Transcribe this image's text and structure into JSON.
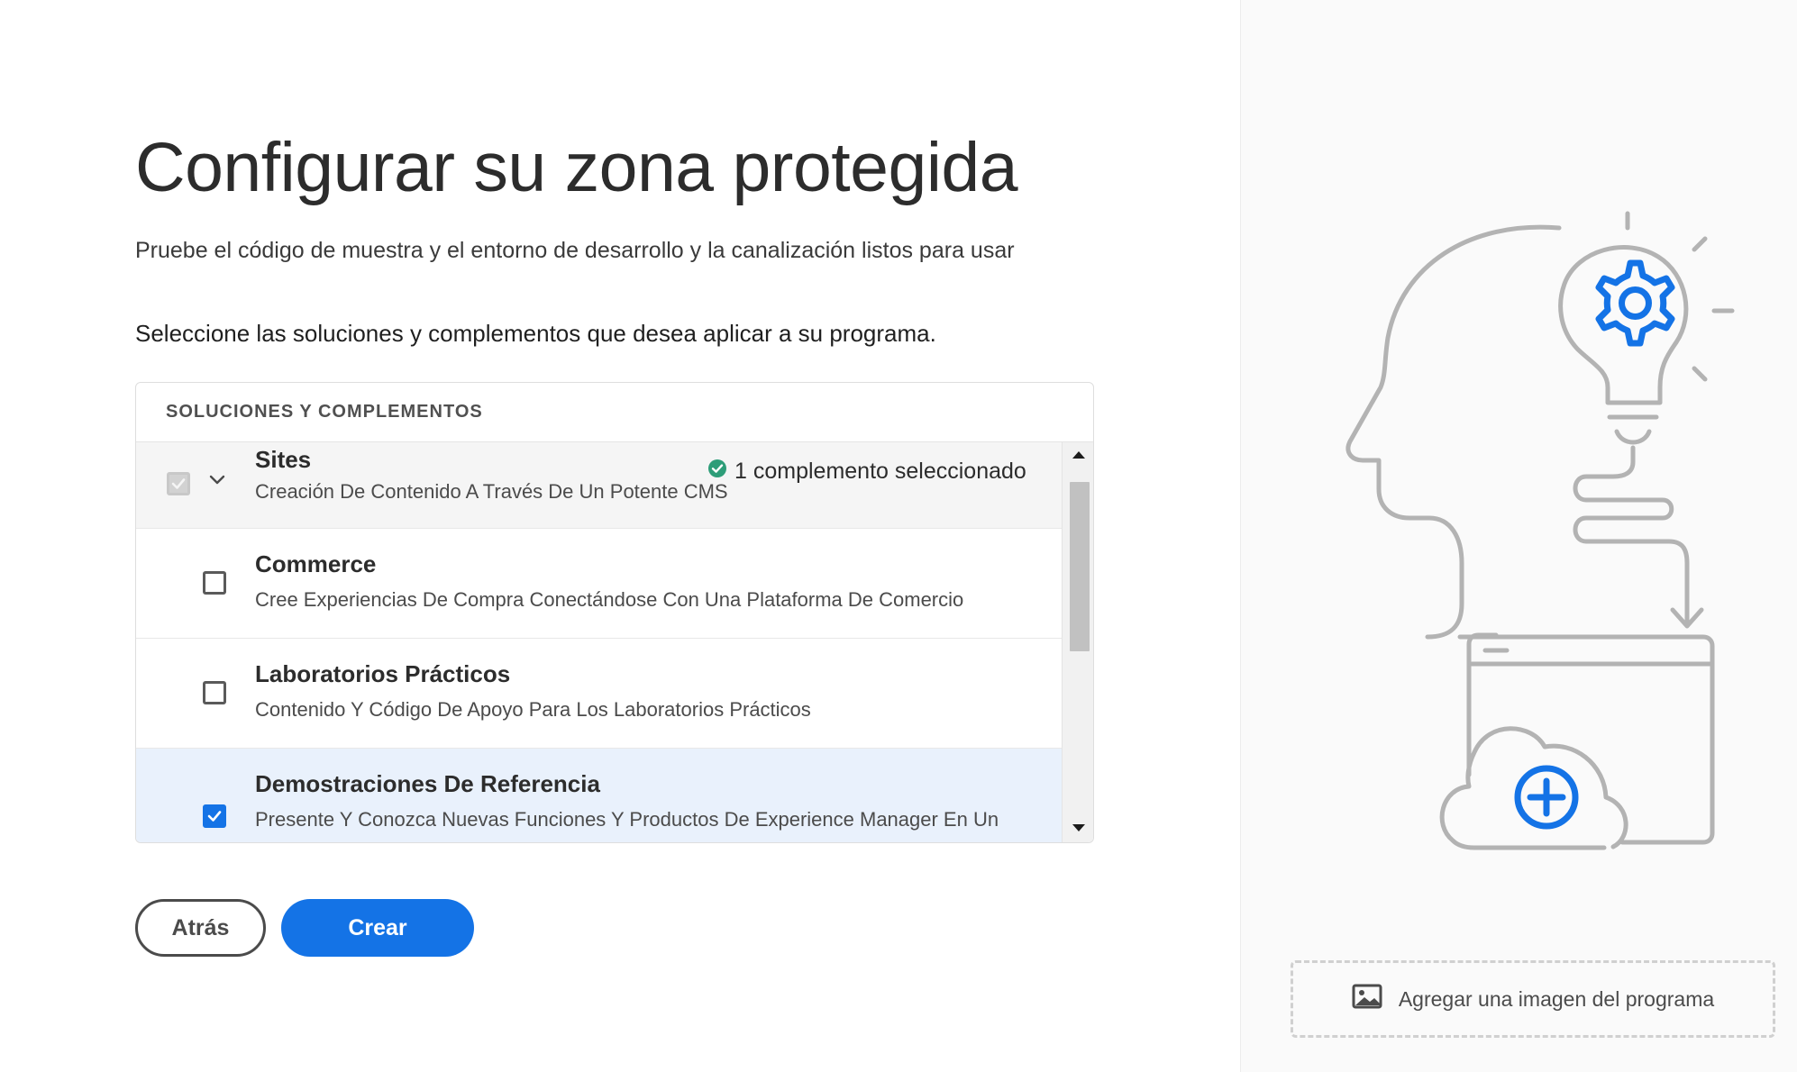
{
  "page": {
    "title": "Configurar su zona protegida",
    "subtitle": "Pruebe el código de muestra y el entorno de desarrollo y la canalización listos para usar",
    "instruction": "Seleccione las soluciones y complementos que desea aplicar a su programa."
  },
  "panel": {
    "header": "SOLUCIONES Y COMPLEMENTOS",
    "solution": {
      "title": "Sites",
      "description": "Creación De Contenido A Través De Un Potente CMS",
      "status": "1 complemento seleccionado",
      "checked": true,
      "disabled": true,
      "expanded": true
    },
    "addons": [
      {
        "title": "Commerce",
        "description": "Cree Experiencias De Compra Conectándose Con Una Plataforma De Comercio",
        "checked": false
      },
      {
        "title": "Laboratorios Prácticos",
        "description": "Contenido Y Código De Apoyo Para Los Laboratorios Prácticos",
        "checked": false
      },
      {
        "title": "Demostraciones De Referencia",
        "description": "Presente Y Conozca Nuevas Funciones Y Productos De Experience Manager En Un",
        "checked": true
      }
    ]
  },
  "buttons": {
    "back": "Atrás",
    "create": "Crear"
  },
  "sidebar": {
    "add_image": "Agregar una imagen del programa"
  },
  "colors": {
    "accent": "#1473e6",
    "success": "#2d9d78",
    "illustration_stroke": "#b3b3b3"
  }
}
